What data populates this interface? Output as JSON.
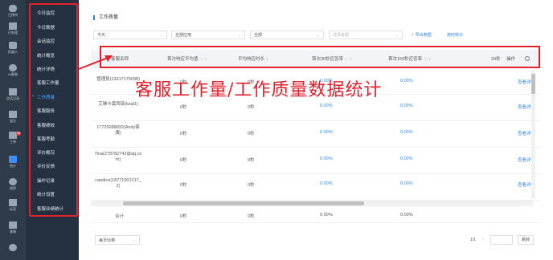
{
  "rail": {
    "items": [
      {
        "label": "已接待",
        "icon": "chat-icon"
      },
      {
        "label": "已处理",
        "icon": "list-icon"
      },
      {
        "label": "机器人",
        "icon": "robot-icon"
      },
      {
        "label": "AI客服",
        "icon": "ai-icon"
      },
      {
        "label": "会话记录",
        "icon": "history-icon"
      },
      {
        "label": "留言",
        "icon": "message-icon"
      },
      {
        "label": "工单",
        "icon": "ticket-icon",
        "badge": "38"
      },
      {
        "label": "统计",
        "icon": "chart-icon",
        "active": true
      },
      {
        "label": "搜索",
        "icon": "search-icon"
      },
      {
        "label": "标签",
        "icon": "tag-icon"
      },
      {
        "label": "客服",
        "icon": "agent-icon"
      },
      {
        "label": "设置",
        "icon": "gear-icon"
      }
    ]
  },
  "submenu": {
    "items": [
      {
        "label": "今日监控"
      },
      {
        "label": "今日数据"
      },
      {
        "label": "会话监控"
      },
      {
        "label": "统计概览"
      },
      {
        "label": "统计详情"
      },
      {
        "label": "客服工作量"
      },
      {
        "label": "工作质量",
        "active": true
      },
      {
        "label": "客服服务"
      },
      {
        "label": "客服绩效"
      },
      {
        "label": "客服考勤"
      },
      {
        "label": "评价概况"
      },
      {
        "label": "评价反馈"
      },
      {
        "label": "操作记录"
      },
      {
        "label": "统计设置"
      },
      {
        "label": "客服业绩统计"
      }
    ]
  },
  "main": {
    "section_title": "工作质量",
    "filters": {
      "date": "今天",
      "app": "全部应用",
      "group": "全部",
      "agent_placeholder": "选择客服"
    },
    "export_label": "导出数据",
    "schedule_label": "按时统计",
    "table": {
      "headers": [
        "客服名称",
        "首次响应平均值",
        "平均响应时长",
        "首次30秒应答率",
        "首次150秒应答率",
        "34秒",
        "操作"
      ],
      "rows": [
        {
          "name": "管理员(13317175098)",
          "first_resp": "0秒",
          "avg_resp": "0秒",
          "rate30": "0.00%",
          "rate150": "0.00%",
          "action": "查看详情"
        },
        {
          "name": "艾琳卡莫西部(ksql1)",
          "first_resp": "0秒",
          "avg_resp": "0秒",
          "rate30": "0.00%",
          "rate150": "0.00%",
          "action": "查看详情"
        },
        {
          "name": "17720088832(Andy客服)",
          "first_resp": "0秒",
          "avg_resp": "0秒",
          "rate30": "0.00%",
          "rate150": "0.00%",
          "action": "查看详情"
        },
        {
          "name": "Tina(278782742@qq.com)",
          "first_resp": "0秒",
          "avg_resp": "0秒",
          "rate30": "0.00%",
          "rate150": "0.00%",
          "action": "查看详情"
        },
        {
          "name": "candice(18771001217_2)",
          "first_resp": "0秒",
          "avg_resp": "0秒",
          "rate30": "0.00%",
          "rate150": "0.00%",
          "action": "查看详情"
        }
      ],
      "total": {
        "label": "合计",
        "first_resp": "0秒",
        "avg_resp": "0秒",
        "rate30": "0.00%",
        "rate150": "0.00%"
      }
    },
    "pagination": {
      "page_size": "每页50条",
      "info": "1/1",
      "next": "›",
      "jump_label": "跳转"
    }
  },
  "annotation": {
    "title": "客服工作量/工作质量数据统计",
    "color": "#e3202c"
  }
}
